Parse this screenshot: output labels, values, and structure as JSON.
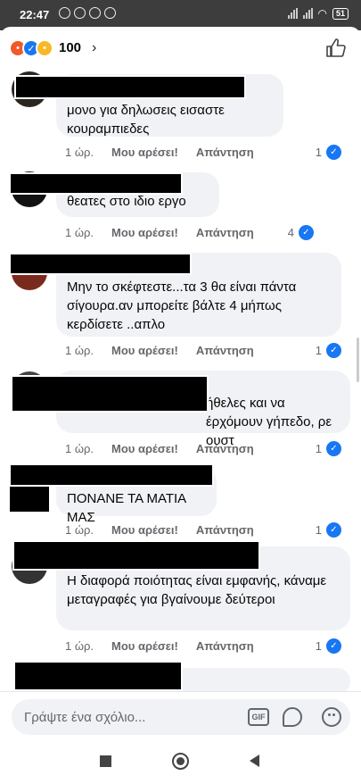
{
  "status_bar": {
    "time": "22:47",
    "battery": "51"
  },
  "header": {
    "reaction_count": "100",
    "chevron": "›"
  },
  "comments": [
    {
      "text": "μονο για δηλωσεις εισαστε κουραμπιεδες",
      "time": "1 ώρ.",
      "like": "Μου αρέσει!",
      "reply": "Απάντηση",
      "reactions": "1"
    },
    {
      "text": "θεατες στο ιδιο εργο",
      "time": "1 ώρ.",
      "like": "Μου αρέσει!",
      "reply": "Απάντηση",
      "reactions": "4"
    },
    {
      "text": "Μην το σκέφτεστε...τα 3 θα είναι πάντα σίγουρα.αν μπορείτε βάλτε 4 μήπως κερδίσετε ..απλο",
      "time": "1 ώρ.",
      "like": "Μου αρέσει!",
      "reply": "Απάντηση",
      "reactions": "1"
    },
    {
      "text": "ήθελες και να έρχόμουν γήπεδο, ρε ουστ",
      "time": "1 ώρ.",
      "like": "Μου αρέσει!",
      "reply": "Απάντηση",
      "reactions": "1"
    },
    {
      "text": "ΠΟΝΑΝΕ ΤΑ ΜΑΤΙΑ ΜΑΣ",
      "time": "1 ώρ.",
      "like": "Μου αρέσει!",
      "reply": "Απάντηση",
      "reactions": "1"
    },
    {
      "text": "Η διαφορά ποιότητας είναι εμφανής, κάναμε μεταγραφές για βγαίνουμε δεύτεροι",
      "time": "1 ώρ.",
      "like": "Μου αρέσει!",
      "reply": "Απάντηση",
      "reactions": "1"
    }
  ],
  "composer": {
    "placeholder": "Γράψτε ένα σχόλιο...",
    "gif_label": "GIF"
  }
}
